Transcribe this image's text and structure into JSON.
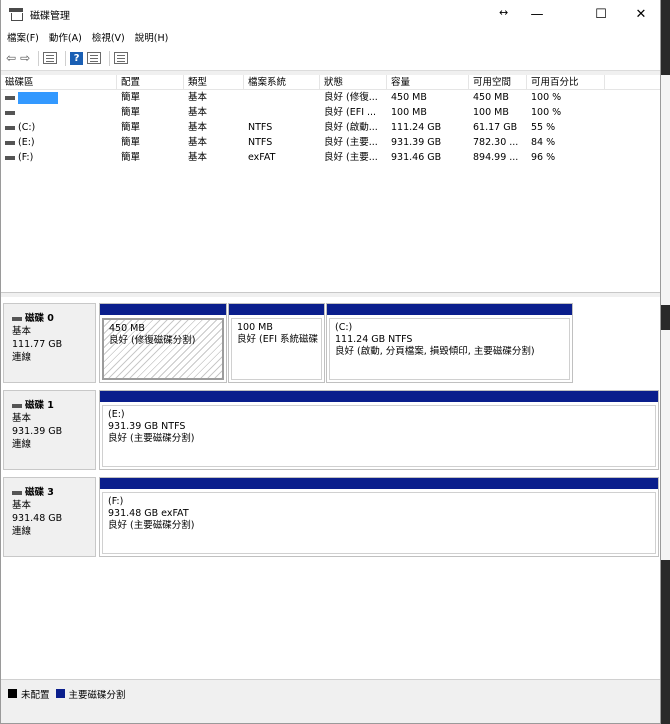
{
  "window": {
    "title": "磁碟管理",
    "minimize": "—",
    "maximize": "☐",
    "close": "✕",
    "resize_glyph": "↔"
  },
  "menu": [
    "檔案(F)",
    "動作(A)",
    "檢視(V)",
    "說明(H)"
  ],
  "toolbar": {
    "icons": [
      "back-arrow-icon",
      "forward-arrow-icon",
      "properties-icon",
      "help-icon",
      "console-icon",
      "view-icon"
    ],
    "back": "⇦",
    "forward": "⇨",
    "help": "?"
  },
  "volume_list": {
    "columns": [
      "磁碟區",
      "配置",
      "類型",
      "檔案系統",
      "狀態",
      "容量",
      "可用空間",
      "可用百分比"
    ],
    "rows": [
      {
        "volume": "",
        "layout": "簡單",
        "type": "基本",
        "fs": "",
        "status": "良好 (修復...",
        "capacity": "450 MB",
        "free": "450 MB",
        "pct": "100 %"
      },
      {
        "volume": "",
        "layout": "簡單",
        "type": "基本",
        "fs": "",
        "status": "良好 (EFI ...",
        "capacity": "100 MB",
        "free": "100 MB",
        "pct": "100 %"
      },
      {
        "volume": "(C:)",
        "layout": "簡單",
        "type": "基本",
        "fs": "NTFS",
        "status": "良好 (啟動...",
        "capacity": "111.24 GB",
        "free": "61.17 GB",
        "pct": "55 %"
      },
      {
        "volume": "(E:)",
        "layout": "簡單",
        "type": "基本",
        "fs": "NTFS",
        "status": "良好 (主要...",
        "capacity": "931.39 GB",
        "free": "782.30 ...",
        "pct": "84 %"
      },
      {
        "volume": "(F:)",
        "layout": "簡單",
        "type": "基本",
        "fs": "exFAT",
        "status": "良好 (主要...",
        "capacity": "931.46 GB",
        "free": "894.99 ...",
        "pct": "96 %"
      }
    ]
  },
  "disks": [
    {
      "name": "磁碟 0",
      "kind": "基本",
      "size": "111.77 GB",
      "state": "連線",
      "partitions": [
        {
          "label": "",
          "size": "450 MB",
          "status": "良好 (修復磁碟分割)"
        },
        {
          "label": "",
          "size": "100 MB",
          "status": "良好 (EFI 系統磁碟"
        },
        {
          "label": "(C:)",
          "size": "111.24 GB NTFS",
          "status": "良好 (啟動, 分頁檔案, 損毀傾印, 主要磁碟分割)"
        }
      ]
    },
    {
      "name": "磁碟 1",
      "kind": "基本",
      "size": "931.39 GB",
      "state": "連線",
      "partitions": [
        {
          "label": "(E:)",
          "size": "931.39 GB NTFS",
          "status": "良好 (主要磁碟分割)"
        }
      ]
    },
    {
      "name": "磁碟 3",
      "kind": "基本",
      "size": "931.48 GB",
      "state": "連線",
      "partitions": [
        {
          "label": "(F:)",
          "size": "931.48 GB exFAT",
          "status": "良好 (主要磁碟分割)"
        }
      ]
    }
  ],
  "legend": [
    {
      "label": "未配置",
      "color": "#000000"
    },
    {
      "label": "主要磁碟分割",
      "color": "#0a1e8c"
    }
  ],
  "colors": {
    "primary_partition": "#0a1e8c",
    "selection": "#3399ff"
  }
}
